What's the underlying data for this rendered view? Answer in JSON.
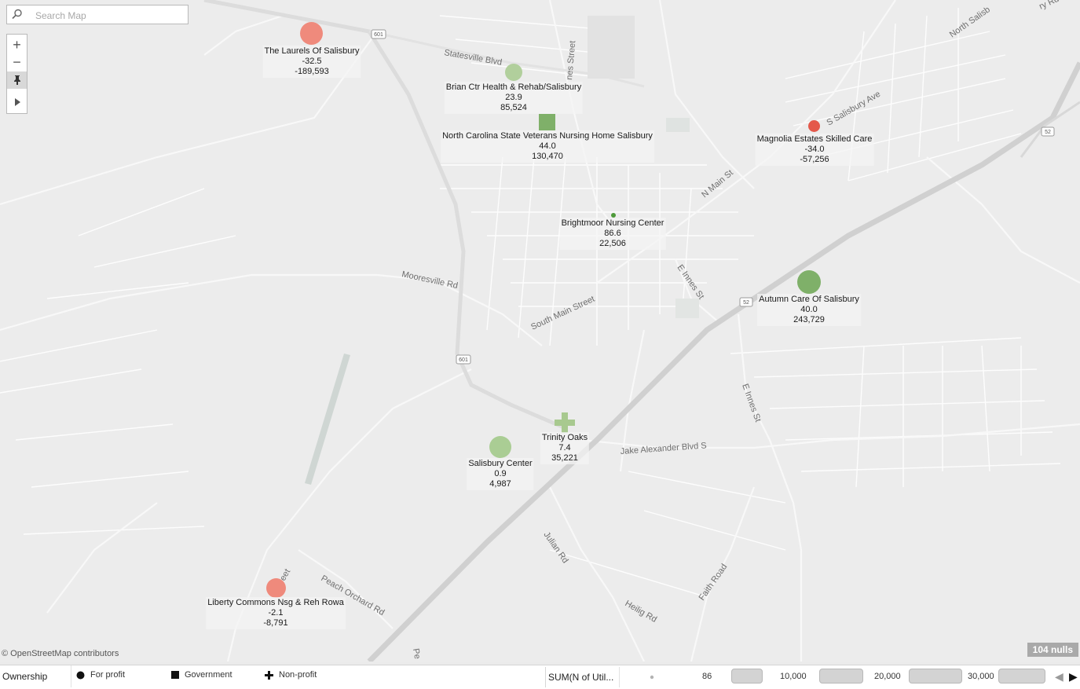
{
  "search": {
    "placeholder": "Search Map"
  },
  "zoom_controls": {
    "zoom_in": "+",
    "zoom_out": "−",
    "pin": "pin-icon",
    "expand": "play-icon"
  },
  "streets": [
    {
      "label": "Statesville Blvd"
    },
    {
      "label": "nes Street"
    },
    {
      "label": "S Salisbury Ave"
    },
    {
      "label": "North Salisb"
    },
    {
      "label": "ry Rd"
    },
    {
      "label": "N Main St"
    },
    {
      "label": "Mooresville Rd"
    },
    {
      "label": "South Main Street"
    },
    {
      "label": "E Innes St"
    },
    {
      "label": "E Innes St"
    },
    {
      "label": "Jake Alexander Blvd S"
    },
    {
      "label": "Julian Rd"
    },
    {
      "label": "Faith Road"
    },
    {
      "label": "Heilig Rd"
    },
    {
      "label": "Peach Orchard Rd"
    },
    {
      "label": "eet"
    },
    {
      "label": "Pe"
    }
  ],
  "route_shields": [
    {
      "label": "601"
    },
    {
      "label": "601"
    },
    {
      "label": "52"
    },
    {
      "label": "52"
    }
  ],
  "facilities": [
    {
      "name": "The Laurels Of Salisbury",
      "v1": "-32.5",
      "v2": "-189,593",
      "ownership": "For profit",
      "color": "#ef8a7c"
    },
    {
      "name": "Brian Ctr Health & Rehab/Salisbury",
      "v1": "23.9",
      "v2": "85,524",
      "ownership": "For profit",
      "color": "#b1cf9c"
    },
    {
      "name": "North Carolina State Veterans Nursing Home Salisbury",
      "v1": "44.0",
      "v2": "130,470",
      "ownership": "Government",
      "color": "#7fb069"
    },
    {
      "name": "Magnolia Estates Skilled Care",
      "v1": "-34.0",
      "v2": "-57,256",
      "ownership": "For profit",
      "color": "#e4594b"
    },
    {
      "name": "Brightmoor Nursing Center",
      "v1": "86.6",
      "v2": "22,506",
      "ownership": "For profit",
      "color": "#4e9a3a"
    },
    {
      "name": "Autumn Care Of Salisbury",
      "v1": "40.0",
      "v2": "243,729",
      "ownership": "For profit",
      "color": "#7fb069"
    },
    {
      "name": "Trinity Oaks",
      "v1": "7.4",
      "v2": "35,221",
      "ownership": "Non-profit",
      "color": "#a8c98f"
    },
    {
      "name": "Salisbury Center",
      "v1": "0.9",
      "v2": "4,987",
      "ownership": "For profit",
      "color": "#aacd94"
    },
    {
      "name": "Liberty Commons Nsg & Reh Rowa",
      "v1": "-2.1",
      "v2": "-8,791",
      "ownership": "For profit",
      "color": "#ef8a7c"
    }
  ],
  "attribution": "© OpenStreetMap contributors",
  "nulls_badge": "104 nulls",
  "legend": {
    "ownership_title": "Ownership",
    "items": [
      {
        "label": "For profit",
        "icon": "circle-icon"
      },
      {
        "label": "Government",
        "icon": "square-icon"
      },
      {
        "label": "Non-profit",
        "icon": "plus-icon"
      }
    ],
    "size_title": "SUM(N of Util...",
    "size_values": [
      "86",
      "10,000",
      "20,000",
      "30,000"
    ]
  }
}
